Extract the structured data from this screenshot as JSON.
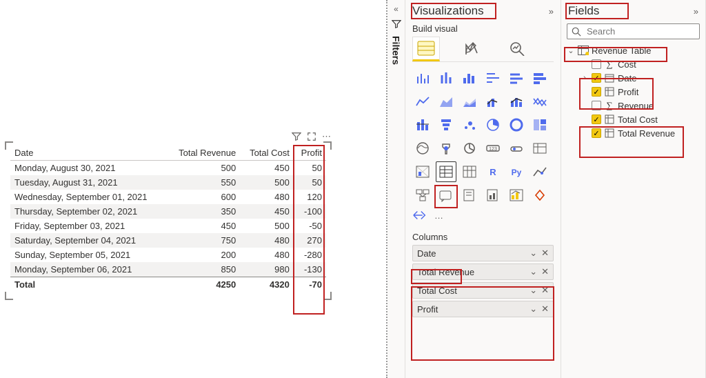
{
  "table": {
    "headers": {
      "c0": "Date",
      "c1": "Total Revenue",
      "c2": "Total Cost",
      "c3": "Profit"
    },
    "rows": [
      {
        "c0": "Monday, August 30, 2021",
        "c1": "500",
        "c2": "450",
        "c3": "50"
      },
      {
        "c0": "Tuesday, August 31, 2021",
        "c1": "550",
        "c2": "500",
        "c3": "50"
      },
      {
        "c0": "Wednesday, September 01, 2021",
        "c1": "600",
        "c2": "480",
        "c3": "120"
      },
      {
        "c0": "Thursday, September 02, 2021",
        "c1": "350",
        "c2": "450",
        "c3": "-100"
      },
      {
        "c0": "Friday, September 03, 2021",
        "c1": "450",
        "c2": "500",
        "c3": "-50"
      },
      {
        "c0": "Saturday, September 04, 2021",
        "c1": "750",
        "c2": "480",
        "c3": "270"
      },
      {
        "c0": "Sunday, September 05, 2021",
        "c1": "200",
        "c2": "480",
        "c3": "-280"
      },
      {
        "c0": "Monday, September 06, 2021",
        "c1": "850",
        "c2": "980",
        "c3": "-130"
      }
    ],
    "total": {
      "c0": "Total",
      "c1": "4250",
      "c2": "4320",
      "c3": "-70"
    }
  },
  "filters": {
    "label": "Filters"
  },
  "viz": {
    "title": "Visualizations",
    "subtitle": "Build visual",
    "columns_label": "Columns",
    "wells": [
      {
        "name": "Date"
      },
      {
        "name": "Total Revenue"
      },
      {
        "name": "Total Cost"
      },
      {
        "name": "Profit"
      }
    ],
    "more": "…"
  },
  "fields": {
    "title": "Fields",
    "search_placeholder": "Search",
    "table_name": "Revenue Table",
    "items": [
      {
        "label": "Cost",
        "checked": false,
        "icon": "sigma"
      },
      {
        "label": "Date",
        "checked": true,
        "icon": "calendar",
        "expandable": true
      },
      {
        "label": "Profit",
        "checked": true,
        "icon": "calc"
      },
      {
        "label": "Revenue",
        "checked": false,
        "icon": "sigma"
      },
      {
        "label": "Total Cost",
        "checked": true,
        "icon": "calc"
      },
      {
        "label": "Total Revenue",
        "checked": true,
        "icon": "calc"
      }
    ]
  },
  "chart_data": {
    "type": "table",
    "title": "",
    "columns": [
      "Date",
      "Total Revenue",
      "Total Cost",
      "Profit"
    ],
    "rows": [
      [
        "Monday, August 30, 2021",
        500,
        450,
        50
      ],
      [
        "Tuesday, August 31, 2021",
        550,
        500,
        50
      ],
      [
        "Wednesday, September 01, 2021",
        600,
        480,
        120
      ],
      [
        "Thursday, September 02, 2021",
        350,
        450,
        -100
      ],
      [
        "Friday, September 03, 2021",
        450,
        500,
        -50
      ],
      [
        "Saturday, September 04, 2021",
        750,
        480,
        270
      ],
      [
        "Sunday, September 05, 2021",
        200,
        480,
        -280
      ],
      [
        "Monday, September 06, 2021",
        850,
        980,
        -130
      ]
    ],
    "totals": [
      "Total",
      4250,
      4320,
      -70
    ]
  }
}
